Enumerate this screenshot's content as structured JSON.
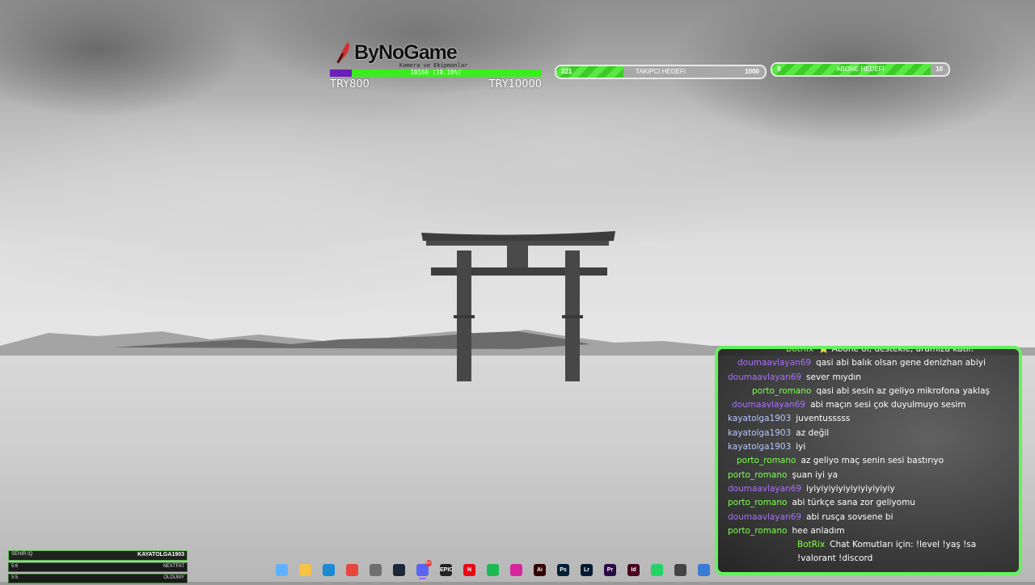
{
  "donation": {
    "brand": "ByNoGame",
    "subtitle": "Kamera ve Ekipmanlar",
    "progress_text": "10166 (10.16%)",
    "progress_fraction": 0.1016,
    "min_label": "TRY800",
    "max_label": "TRY10000"
  },
  "follower_goal": {
    "current": "321",
    "title": "TAKIPCI HEDEFI",
    "max": "1000",
    "fraction": 0.321
  },
  "sub_goal": {
    "current": "9",
    "title": "ABONE HEDEFI",
    "max": "10",
    "fraction": 0.9
  },
  "chat": {
    "messages": [
      {
        "user": "BotRix",
        "text": "⭐ Abone ol, destekle, aramıza katıl!",
        "user_color": "#8dff4f",
        "indent": 72
      },
      {
        "user": "doumaavlayan69",
        "text": "qasi abi balık olsan gene denizhan abiyi",
        "user_color": "#a970ff",
        "indent": 12
      },
      {
        "user": "doumaavlayan69",
        "text": "sever mıydın",
        "user_color": "#a970ff",
        "indent": 0
      },
      {
        "user": "porto_romano",
        "text": "qasi abi sesin az geliyo mikrofona yaklaş",
        "user_color": "#7cff4f",
        "indent": 30
      },
      {
        "user": "doumaavlayan69",
        "text": "abi maçın sesi çok duyulmuyo sesim",
        "user_color": "#a970ff",
        "indent": 5
      },
      {
        "user": "kayatolga1903",
        "text": "juventusssss",
        "user_color": "#b8c8ff",
        "indent": 0
      },
      {
        "user": "kayatolga1903",
        "text": "az değil",
        "user_color": "#b8c8ff",
        "indent": 0
      },
      {
        "user": "kayatolga1903",
        "text": "iyi",
        "user_color": "#b8c8ff",
        "indent": 0
      },
      {
        "user": "porto_romano",
        "text": "az geliyo maç senin sesi bastırıyo",
        "user_color": "#7cff4f",
        "indent": 11
      },
      {
        "user": "porto_romano",
        "text": "şuan iyi ya",
        "user_color": "#7cff4f",
        "indent": 0
      },
      {
        "user": "doumaavlayan69",
        "text": "iyiyiyiyiyiyiyiyiyiyiyiy",
        "user_color": "#a970ff",
        "indent": 0
      },
      {
        "user": "porto_romano",
        "text": "abi türkçe sana zor geliyomu",
        "user_color": "#7cff4f",
        "indent": 0
      },
      {
        "user": "doumaavlayan69",
        "text": "abi rusça sovsene bi",
        "user_color": "#a970ff",
        "indent": 0
      },
      {
        "user": "porto_romano",
        "text": "hee anladım",
        "user_color": "#7cff4f",
        "indent": 0
      },
      {
        "user": "BotRix",
        "text": "Chat Komutları için: !level !yaş !sa !valorant !discord",
        "user_color": "#8dff4f",
        "indent": 86
      }
    ]
  },
  "bottom_widget": {
    "title_left": "SEHIR IQ",
    "title_right": "KAYATOLGA1903",
    "row2_left": "5:6",
    "row2_right": "NEXTFAT",
    "row3_left": "5:5",
    "row3_right": "OLDUMY"
  },
  "taskbar": {
    "apps": [
      {
        "name": "task-view-icon",
        "color": "#5fb0ff",
        "label": ""
      },
      {
        "name": "file-explorer-icon",
        "color": "#f6c343",
        "label": ""
      },
      {
        "name": "edge-icon",
        "color": "#1a8ad4",
        "label": ""
      },
      {
        "name": "chrome-icon",
        "color": "#e8453c",
        "label": ""
      },
      {
        "name": "microsoft-store-icon",
        "color": "#6f6f6f",
        "label": ""
      },
      {
        "name": "steam-icon",
        "color": "#1b2838",
        "label": ""
      },
      {
        "name": "discord-icon",
        "color": "#5865f2",
        "label": "",
        "badge": "9+",
        "active": true
      },
      {
        "name": "epic-games-icon",
        "color": "#222222",
        "label": "EPIC"
      },
      {
        "name": "netflix-icon",
        "color": "#e50914",
        "label": "N"
      },
      {
        "name": "spotify-icon",
        "color": "#1db954",
        "label": ""
      },
      {
        "name": "instagram-icon",
        "color": "#d6249f",
        "label": ""
      },
      {
        "name": "illustrator-icon",
        "color": "#330000",
        "label": "Ai"
      },
      {
        "name": "photoshop-icon",
        "color": "#001e36",
        "label": "Ps"
      },
      {
        "name": "lightroom-icon",
        "color": "#001a33",
        "label": "Lr"
      },
      {
        "name": "premiere-icon",
        "color": "#2a0a47",
        "label": "Pr"
      },
      {
        "name": "indesign-icon",
        "color": "#49021f",
        "label": "Id"
      },
      {
        "name": "whatsapp-icon",
        "color": "#25d366",
        "label": ""
      },
      {
        "name": "obs-icon",
        "color": "#444444",
        "label": ""
      },
      {
        "name": "app-icon",
        "color": "#3a7bd5",
        "label": ""
      }
    ]
  }
}
